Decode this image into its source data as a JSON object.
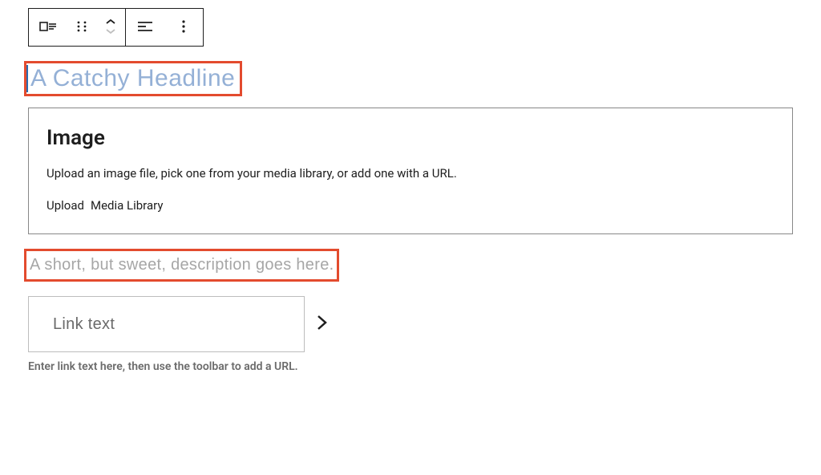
{
  "headline_placeholder": "A Catchy Headline",
  "image_block": {
    "title": "Image",
    "description": "Upload an image file, pick one from your media library, or add one with a URL.",
    "upload_label": "Upload",
    "media_library_label": "Media Library"
  },
  "description_placeholder": "A short, but sweet, description goes here.",
  "link": {
    "placeholder": "Link text",
    "hint": "Enter link text here, then use the toolbar to add a URL."
  }
}
